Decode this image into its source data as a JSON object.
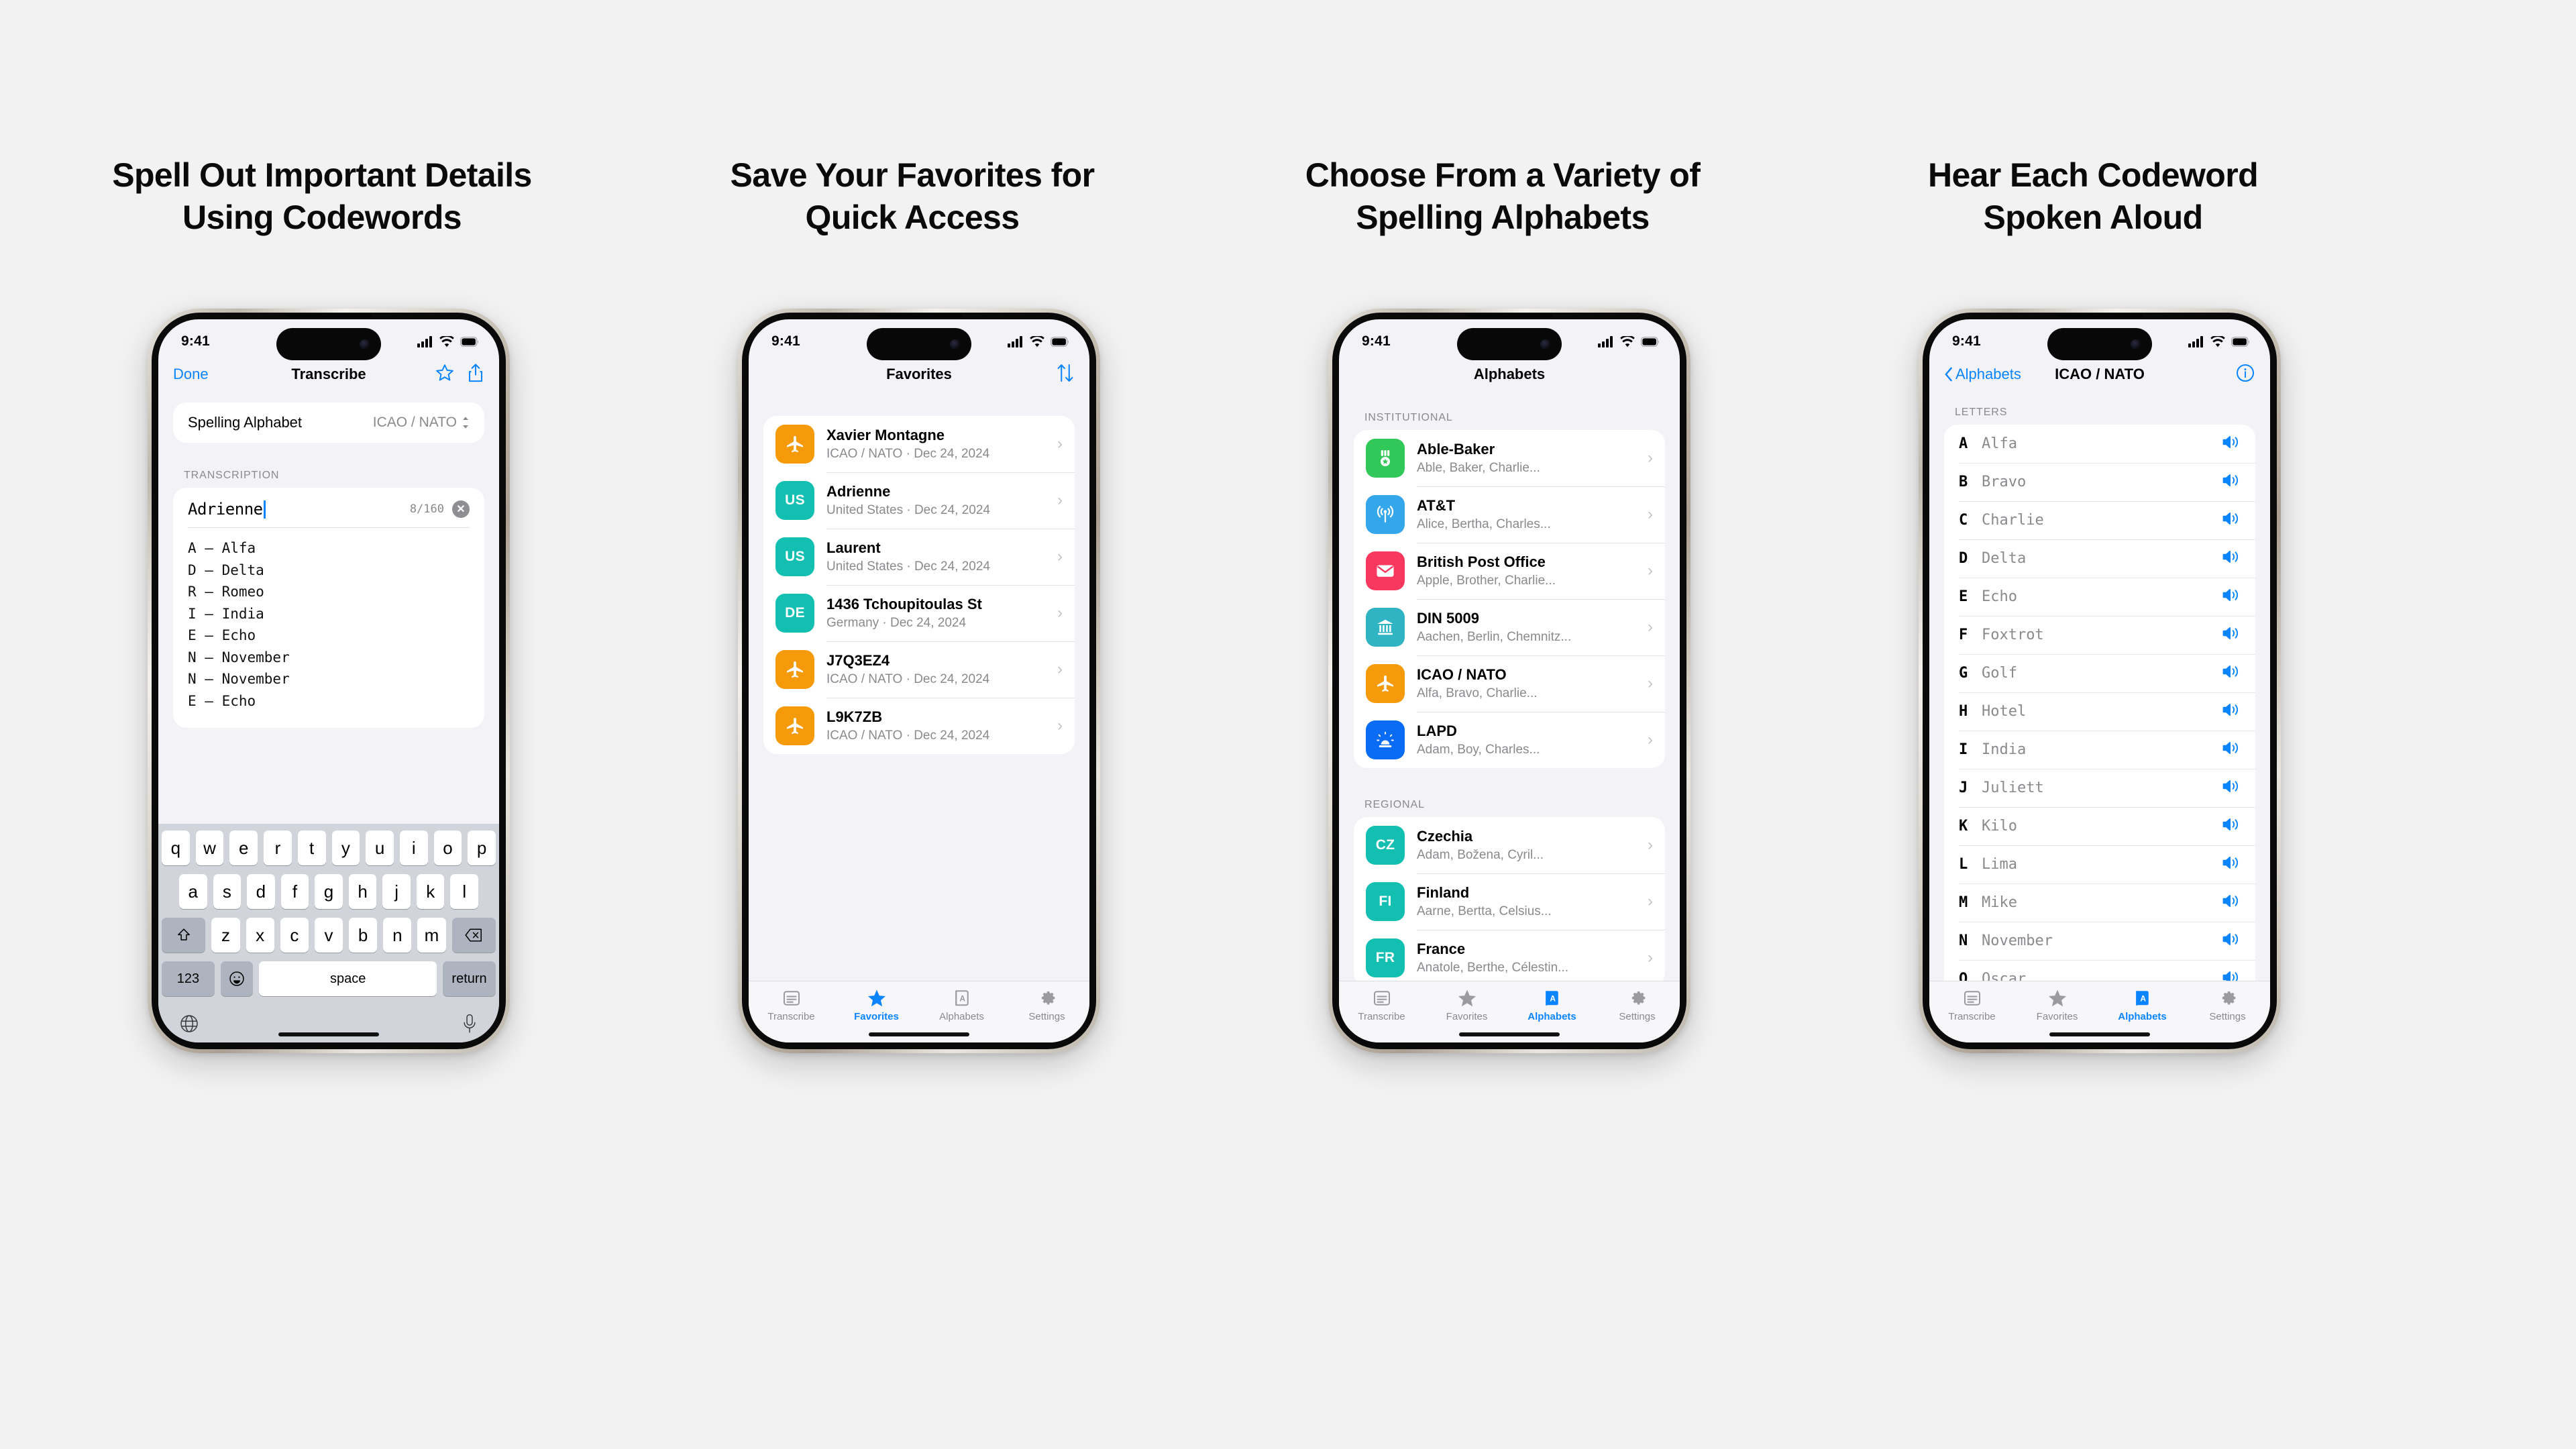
{
  "colors": {
    "page_bg": "#f2f2f2",
    "accent_blue": "#0a84ff",
    "screen_bg": "#f2f2f7",
    "icon_orange": "#f59a0b",
    "icon_teal": "#12bfb0",
    "icon_green": "#32c759",
    "icon_lightblue": "#34a7eb",
    "icon_pink": "#f8385f",
    "icon_cyan": "#30b4c4",
    "icon_blue": "#0a6bf5"
  },
  "panels": [
    {
      "headline": [
        "Spell Out Important Details",
        "Using Codewords"
      ],
      "status": {
        "time": "9:41"
      },
      "nav": {
        "left": "Done",
        "title": "Transcribe",
        "star_icon": "star-outline-icon",
        "share_icon": "share-icon"
      },
      "alphabet_picker": {
        "label": "Spelling Alphabet",
        "value": "ICAO / NATO"
      },
      "section_label": "TRANSCRIPTION",
      "input": {
        "value": "Adrienne",
        "counter": "8/160",
        "clear_icon": "clear-circle-icon"
      },
      "codewords": [
        "A — Alfa",
        "D — Delta",
        "R — Romeo",
        "I — India",
        "E — Echo",
        "N — November",
        "N — November",
        "E — Echo"
      ],
      "keyboard": {
        "row1": [
          "q",
          "w",
          "e",
          "r",
          "t",
          "y",
          "u",
          "i",
          "o",
          "p"
        ],
        "row2": [
          "a",
          "s",
          "d",
          "f",
          "g",
          "h",
          "j",
          "k",
          "l"
        ],
        "row3": [
          "z",
          "x",
          "c",
          "v",
          "b",
          "n",
          "m"
        ],
        "shift_icon": "shift-icon",
        "backspace_icon": "backspace-icon",
        "numbers_key": "123",
        "emoji_icon": "emoji-icon",
        "space_key": "space",
        "return_key": "return",
        "globe_icon": "globe-icon",
        "mic_icon": "microphone-icon"
      }
    },
    {
      "headline": [
        "Save Your Favorites for",
        "Quick Access"
      ],
      "status": {
        "time": "9:41"
      },
      "nav": {
        "title": "Favorites",
        "sort_icon": "sort-arrows-icon"
      },
      "favorites": [
        {
          "badge": "plane",
          "color": "#f59a0b",
          "title": "Xavier Montagne",
          "sub": "ICAO / NATO · Dec 24, 2024"
        },
        {
          "badge": "US",
          "color": "#12bfb0",
          "title": "Adrienne",
          "sub": "United States · Dec 24, 2024"
        },
        {
          "badge": "US",
          "color": "#12bfb0",
          "title": "Laurent",
          "sub": "United States · Dec 24, 2024"
        },
        {
          "badge": "DE",
          "color": "#12bfb0",
          "title": "1436 Tchoupitoulas St",
          "sub": "Germany · Dec 24, 2024"
        },
        {
          "badge": "plane",
          "color": "#f59a0b",
          "title": "J7Q3EZ4",
          "sub": "ICAO / NATO · Dec 24, 2024"
        },
        {
          "badge": "plane",
          "color": "#f59a0b",
          "title": "L9K7ZB",
          "sub": "ICAO / NATO · Dec 24, 2024"
        }
      ],
      "tabs": [
        {
          "label": "Transcribe",
          "icon": "document-icon",
          "active": false
        },
        {
          "label": "Favorites",
          "icon": "star-icon",
          "active": true
        },
        {
          "label": "Alphabets",
          "icon": "book-icon",
          "active": false
        },
        {
          "label": "Settings",
          "icon": "gear-icon",
          "active": false
        }
      ]
    },
    {
      "headline": [
        "Choose From a Variety of",
        "Spelling Alphabets"
      ],
      "status": {
        "time": "9:41"
      },
      "nav": {
        "title": "Alphabets"
      },
      "groups": [
        {
          "header": "INSTITUTIONAL",
          "items": [
            {
              "badge": "medal",
              "color": "#32c759",
              "title": "Able-Baker",
              "sub": "Able, Baker, Charlie..."
            },
            {
              "badge": "antenna",
              "color": "#34a7eb",
              "title": "AT&T",
              "sub": "Alice, Bertha, Charles..."
            },
            {
              "badge": "envelope",
              "color": "#f8385f",
              "title": "British Post Office",
              "sub": "Apple, Brother, Charlie..."
            },
            {
              "badge": "bank",
              "color": "#30b4c4",
              "title": "DIN 5009",
              "sub": "Aachen, Berlin, Chemnitz..."
            },
            {
              "badge": "plane",
              "color": "#f59a0b",
              "title": "ICAO / NATO",
              "sub": "Alfa, Bravo, Charlie..."
            },
            {
              "badge": "siren",
              "color": "#0a6bf5",
              "title": "LAPD",
              "sub": "Adam, Boy, Charles..."
            }
          ]
        },
        {
          "header": "REGIONAL",
          "items": [
            {
              "badge": "CZ",
              "color": "#12bfb0",
              "title": "Czechia",
              "sub": "Adam, Božena, Cyril..."
            },
            {
              "badge": "FI",
              "color": "#12bfb0",
              "title": "Finland",
              "sub": "Aarne, Bertta, Celsius..."
            },
            {
              "badge": "FR",
              "color": "#12bfb0",
              "title": "France",
              "sub": "Anatole, Berthe, Célestin..."
            }
          ]
        }
      ],
      "tabs": [
        {
          "label": "Transcribe",
          "icon": "document-icon",
          "active": false
        },
        {
          "label": "Favorites",
          "icon": "star-icon",
          "active": false
        },
        {
          "label": "Alphabets",
          "icon": "book-icon",
          "active": true
        },
        {
          "label": "Settings",
          "icon": "gear-icon",
          "active": false
        }
      ]
    },
    {
      "headline": [
        "Hear Each Codeword",
        "Spoken Aloud"
      ],
      "status": {
        "time": "9:41"
      },
      "nav": {
        "back": "Alphabets",
        "title": "ICAO / NATO",
        "info_icon": "info-circle-icon"
      },
      "section_label": "LETTERS",
      "letters": [
        {
          "key": "A",
          "word": "Alfa"
        },
        {
          "key": "B",
          "word": "Bravo"
        },
        {
          "key": "C",
          "word": "Charlie"
        },
        {
          "key": "D",
          "word": "Delta"
        },
        {
          "key": "E",
          "word": "Echo"
        },
        {
          "key": "F",
          "word": "Foxtrot"
        },
        {
          "key": "G",
          "word": "Golf"
        },
        {
          "key": "H",
          "word": "Hotel"
        },
        {
          "key": "I",
          "word": "India"
        },
        {
          "key": "J",
          "word": "Juliett"
        },
        {
          "key": "K",
          "word": "Kilo"
        },
        {
          "key": "L",
          "word": "Lima"
        },
        {
          "key": "M",
          "word": "Mike"
        },
        {
          "key": "N",
          "word": "November"
        },
        {
          "key": "O",
          "word": "Oscar"
        }
      ],
      "tabs": [
        {
          "label": "Transcribe",
          "icon": "document-icon",
          "active": false
        },
        {
          "label": "Favorites",
          "icon": "star-icon",
          "active": false
        },
        {
          "label": "Alphabets",
          "icon": "book-icon",
          "active": true
        },
        {
          "label": "Settings",
          "icon": "gear-icon",
          "active": false
        }
      ]
    }
  ]
}
